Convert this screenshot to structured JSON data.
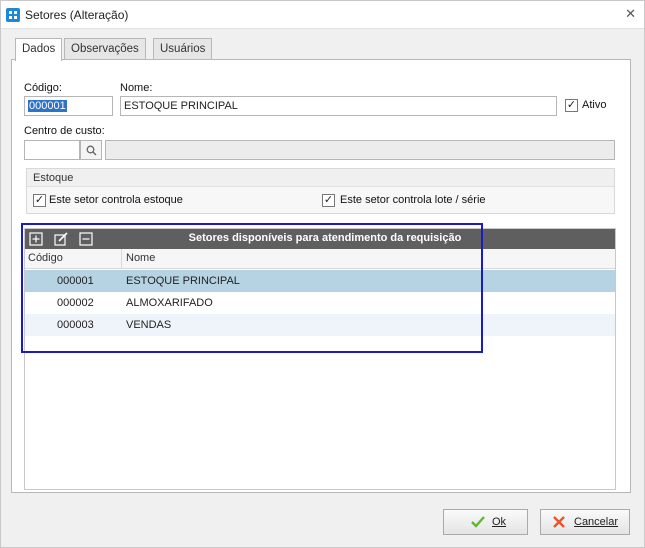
{
  "window": {
    "title": "Setores (Alteração)"
  },
  "tabs": [
    {
      "label": "Dados"
    },
    {
      "label": "Observações"
    },
    {
      "label": "Usuários"
    }
  ],
  "form": {
    "codigo_label": "Código:",
    "codigo_value": "000001",
    "nome_label": "Nome:",
    "nome_value": "ESTOQUE PRINCIPAL",
    "ativo_label": "Ativo",
    "ativo_checked": true,
    "centro_label": "Centro de custo:",
    "centro_code": "",
    "centro_desc": ""
  },
  "estoque": {
    "title": "Estoque",
    "controla_estoque_label": "Este setor controla estoque",
    "controla_estoque_checked": true,
    "controla_lote_label": "Este setor controla lote / série",
    "controla_lote_checked": true
  },
  "grid": {
    "title": "Setores disponíveis para atendimento da requisição",
    "columns": [
      "Código",
      "Nome"
    ],
    "rows": [
      {
        "codigo": "000001",
        "nome": "ESTOQUE PRINCIPAL",
        "selected": true
      },
      {
        "codigo": "000002",
        "nome": "ALMOXARIFADO",
        "selected": false
      },
      {
        "codigo": "000003",
        "nome": "VENDAS",
        "selected": false
      }
    ]
  },
  "buttons": {
    "ok_label": "Ok",
    "cancel_label": "Cancelar"
  },
  "colors": {
    "selected_row": "#b6d3e4",
    "grid_header_bar": "#5f5f5f",
    "highlight_border": "#1b1bc4",
    "ok_check": "#5cb82e",
    "cancel_x": "#e8542b"
  },
  "icons": [
    "app-icon",
    "close-icon",
    "search-icon",
    "add-icon",
    "edit-icon",
    "remove-icon",
    "check-icon",
    "x-icon"
  ]
}
